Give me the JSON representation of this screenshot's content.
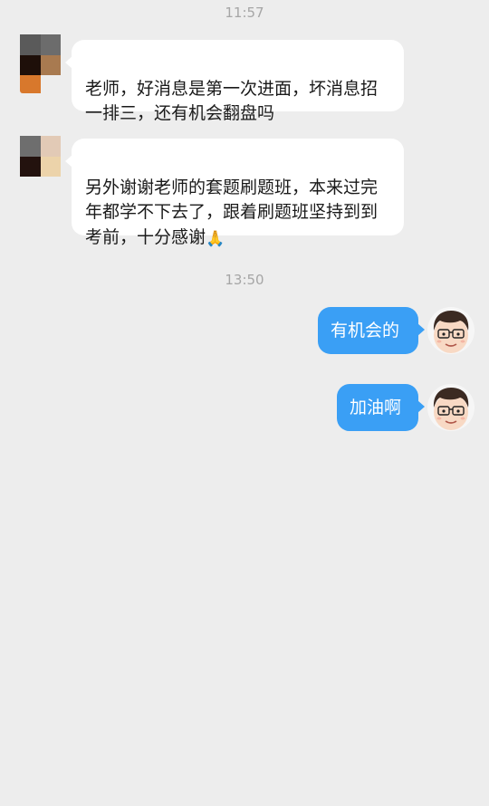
{
  "chat": {
    "time_1": "11:57",
    "time_2": "13:50",
    "messages": [
      {
        "side": "in",
        "text": "老师，好消息是第一次进面，坏消息招一排三，还有机会翻盘吗"
      },
      {
        "side": "in",
        "text": "另外谢谢老师的套题刷题班，本来过完年都学不下去了，跟着刷题班坚持到到考前，十分感谢",
        "emoji": "🙏"
      },
      {
        "side": "out",
        "text": "有机会的"
      },
      {
        "side": "out",
        "text": "加油啊"
      }
    ]
  },
  "colors": {
    "background": "#ededed",
    "incoming_bubble": "#ffffff",
    "outgoing_bubble": "#3a9ff5",
    "timestamp_text": "#a6a6a6"
  },
  "icons": {
    "contact_avatar": "pixelated-avatar-icon",
    "self_avatar": "cartoon-man-with-glasses-avatar"
  }
}
